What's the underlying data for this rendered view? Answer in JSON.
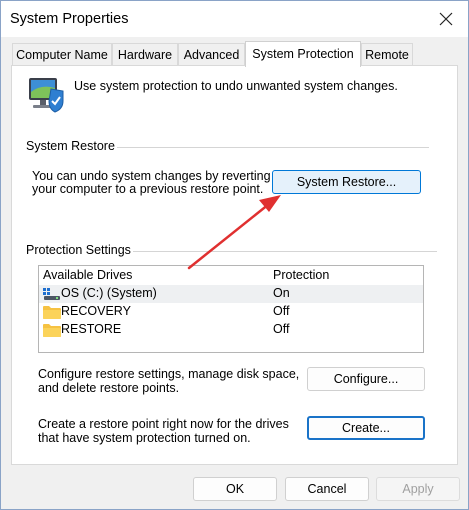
{
  "window": {
    "title": "System Properties"
  },
  "tabs": [
    {
      "label": "Computer Name"
    },
    {
      "label": "Hardware"
    },
    {
      "label": "Advanced"
    },
    {
      "label": "System Protection"
    },
    {
      "label": "Remote"
    }
  ],
  "intro_text": "Use system protection to undo unwanted system changes.",
  "system_restore": {
    "heading": "System Restore",
    "description_line1": "You can undo system changes by reverting",
    "description_line2": "your computer to a previous restore point.",
    "button_label": "System Restore..."
  },
  "protection_settings": {
    "heading": "Protection Settings",
    "columns": [
      "Available Drives",
      "Protection"
    ],
    "drives": [
      {
        "name": "OS (C:) (System)",
        "protection": "On",
        "icon": "system-drive-icon"
      },
      {
        "name": "RECOVERY",
        "protection": "Off",
        "icon": "folder-icon"
      },
      {
        "name": "RESTORE",
        "protection": "Off",
        "icon": "folder-icon"
      }
    ],
    "configure_text_line1": "Configure restore settings, manage disk space,",
    "configure_text_line2": "and delete restore points.",
    "configure_button": "Configure...",
    "create_text_line1": "Create a restore point right now for the drives",
    "create_text_line2": "that have system protection turned on.",
    "create_button": "Create..."
  },
  "buttons": {
    "ok": "OK",
    "cancel": "Cancel",
    "apply": "Apply"
  },
  "colors": {
    "accent": "#0078d7",
    "annotation_arrow": "#e03030",
    "folder": "#f6c242"
  }
}
